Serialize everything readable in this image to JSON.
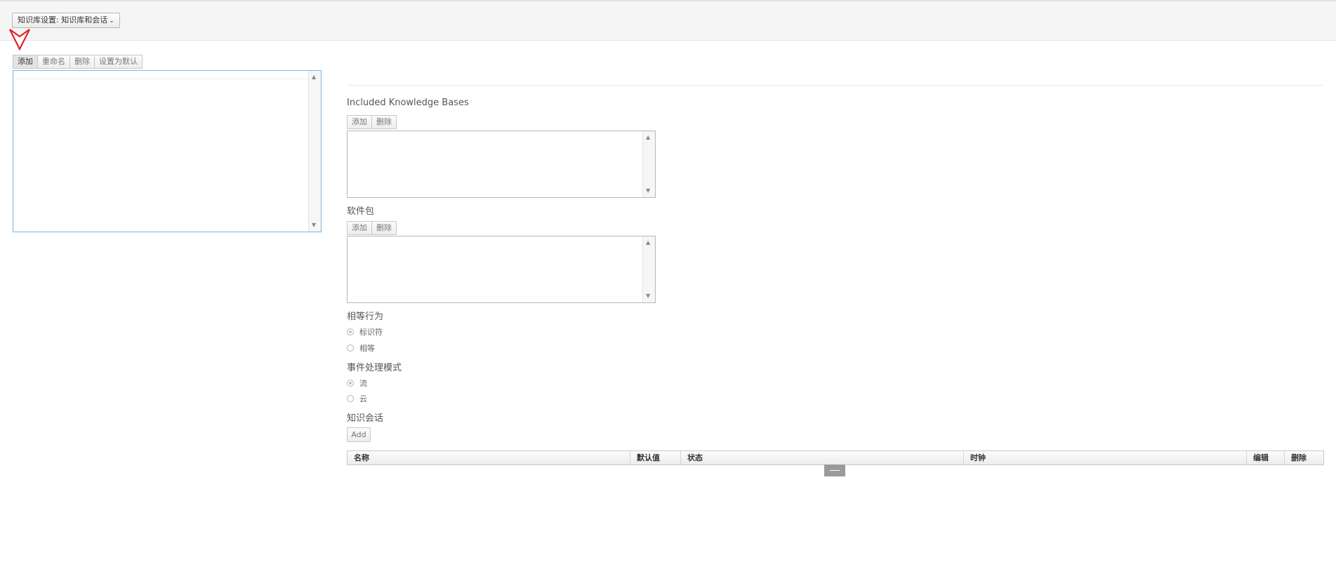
{
  "header": {
    "kb_selector_label": "知识库设置: 知识库和会话",
    "chevron_icon": "chevron-down-icon"
  },
  "left_panel": {
    "buttons": [
      "添加",
      "重命名",
      "删除",
      "设置为默认"
    ]
  },
  "included_kbs": {
    "title": "Included Knowledge Bases",
    "buttons": [
      "添加",
      "删除"
    ]
  },
  "packages": {
    "title": "软件包",
    "buttons": [
      "添加",
      "删除"
    ]
  },
  "equality_behavior": {
    "title": "相等行为",
    "options": [
      "标识符",
      "相等"
    ],
    "selected_index": 0
  },
  "event_mode": {
    "title": "事件处理模式",
    "options": [
      "流",
      "云"
    ],
    "selected_index": 0
  },
  "sessions": {
    "title": "知识会话",
    "add_label": "Add",
    "columns": [
      "名称",
      "默认值",
      "状态",
      "时钟",
      "编辑",
      "删除"
    ]
  },
  "colors": {
    "pointer_red": "#e0212b",
    "focus_border": "#7fb5dd"
  }
}
